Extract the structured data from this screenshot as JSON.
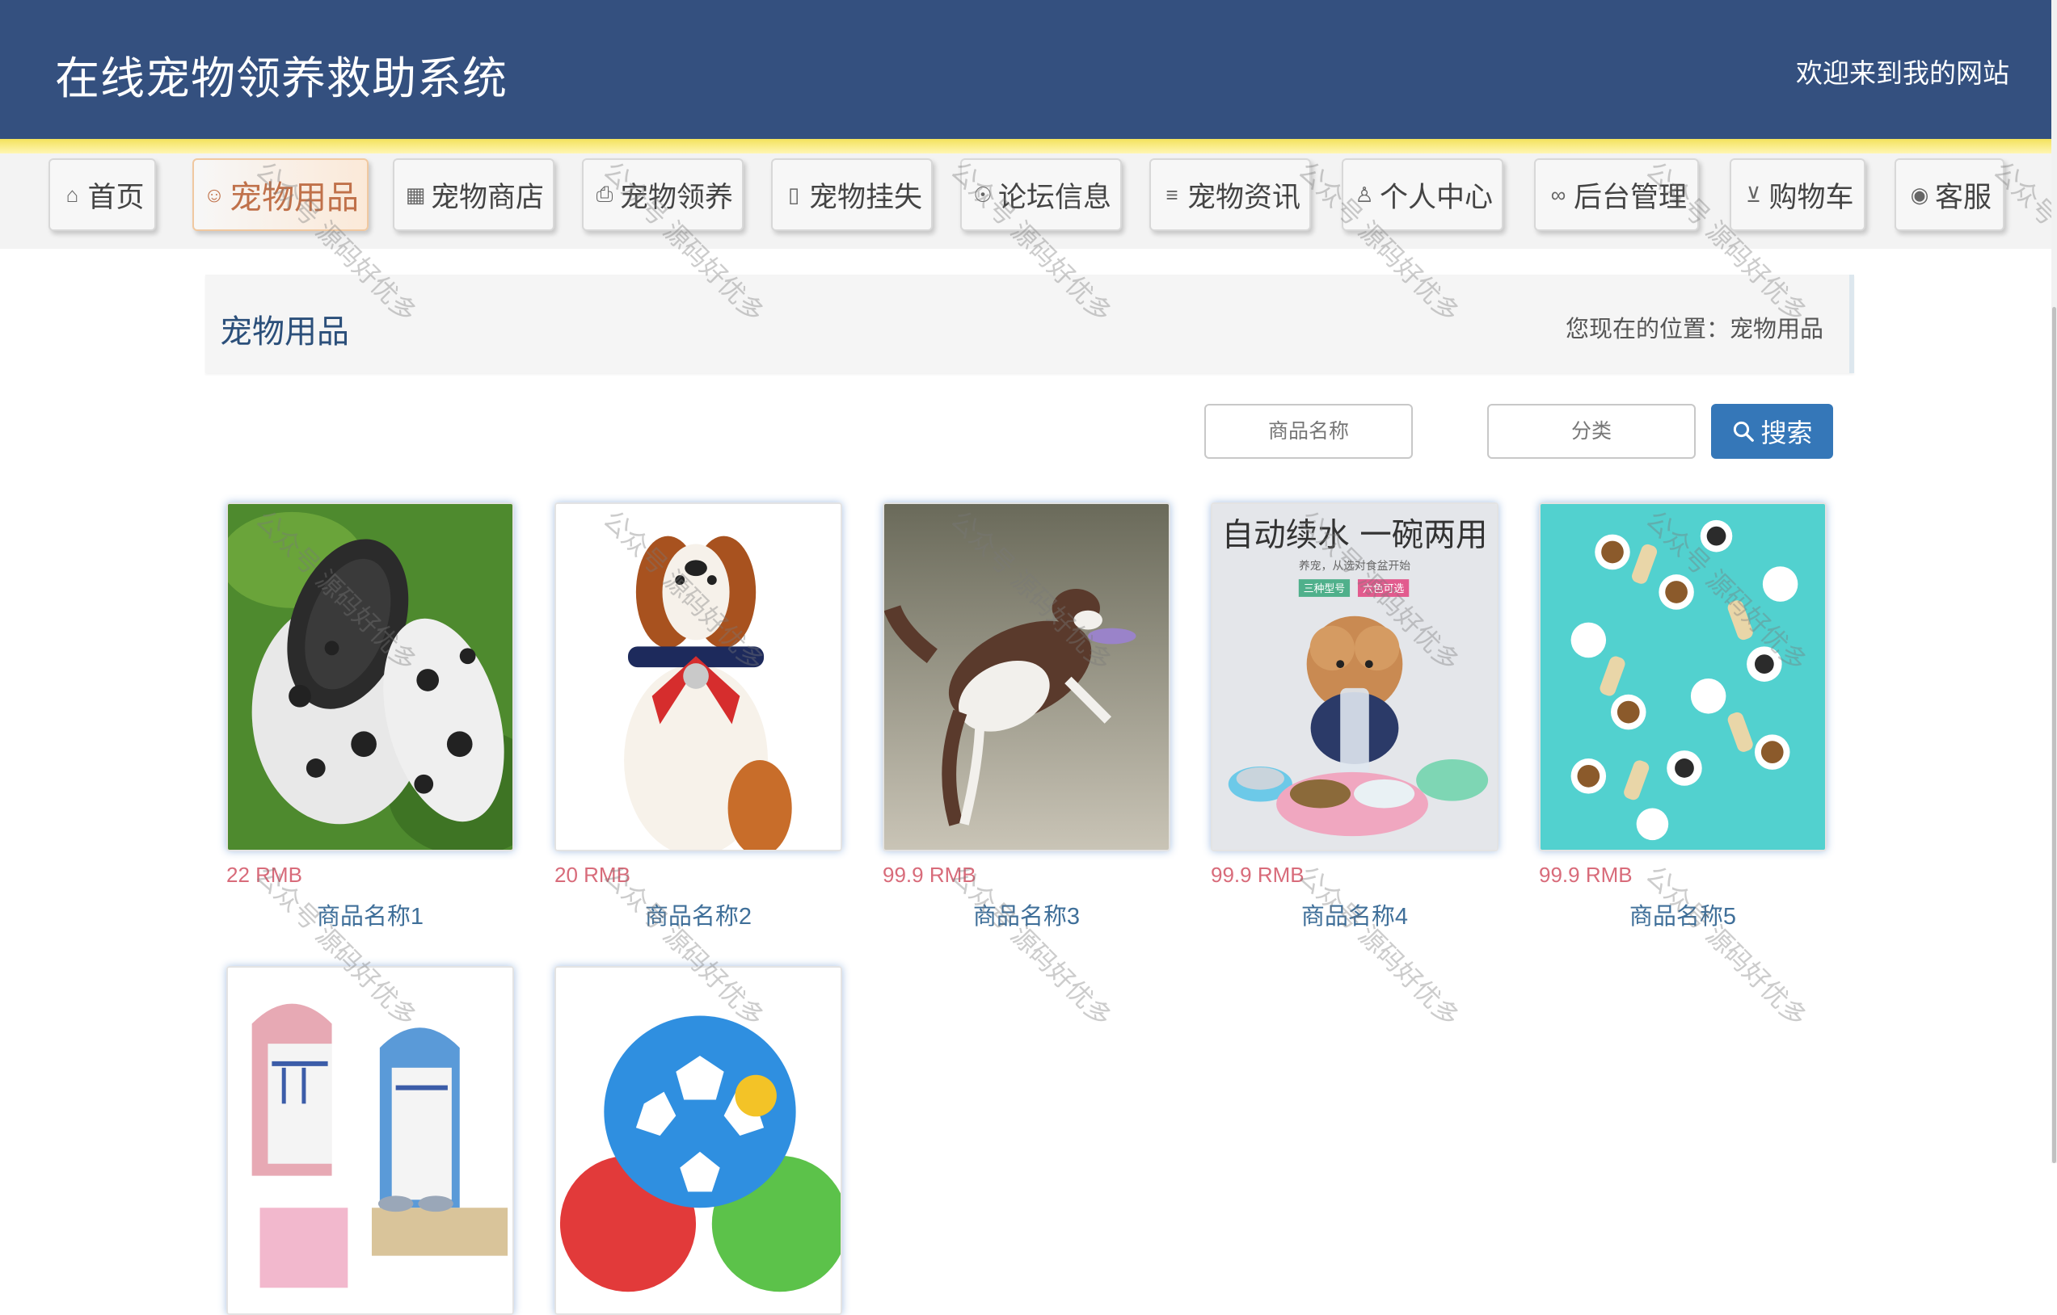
{
  "header": {
    "title": "在线宠物领养救助系统",
    "welcome": "欢迎来到我的网站"
  },
  "nav": {
    "items": [
      {
        "label": "首页",
        "icon": "home-icon",
        "glyph": "⌂"
      },
      {
        "label": "宠物用品",
        "icon": "smile-icon",
        "glyph": "☺",
        "active": true
      },
      {
        "label": "宠物商店",
        "icon": "grid-icon",
        "glyph": "▦"
      },
      {
        "label": "宠物领养",
        "icon": "printer-icon",
        "glyph": "⎙"
      },
      {
        "label": "宠物挂失",
        "icon": "columns-icon",
        "glyph": "▯"
      },
      {
        "label": "论坛信息",
        "icon": "gamepad-icon",
        "glyph": "☉"
      },
      {
        "label": "宠物资讯",
        "icon": "sliders-icon",
        "glyph": "≡"
      },
      {
        "label": "个人中心",
        "icon": "user-icon",
        "glyph": "♙"
      },
      {
        "label": "后台管理",
        "icon": "link-icon",
        "glyph": "∞"
      },
      {
        "label": "购物车",
        "icon": "cart-icon",
        "glyph": "⊻"
      },
      {
        "label": "客服",
        "icon": "chat-icon",
        "glyph": "◉"
      }
    ]
  },
  "breadcrumb": {
    "title": "宠物用品",
    "location": "您现在的位置：宠物用品"
  },
  "search": {
    "name_placeholder": "商品名称",
    "category_placeholder": "分类",
    "button_label": "搜索",
    "button_icon": "search-icon"
  },
  "products": [
    {
      "price": "22 RMB",
      "name": "商品名称1",
      "image": "pet-shoes-image"
    },
    {
      "price": "20 RMB",
      "name": "商品名称2",
      "image": "dog-bowtie-image"
    },
    {
      "price": "99.9 RMB",
      "name": "商品名称3",
      "image": "dog-frisbee-image"
    },
    {
      "price": "99.9 RMB",
      "name": "商品名称4",
      "image": "pet-bowl-image",
      "overlay_title": "自动续水 一碗两用",
      "overlay_sub": "养宠，从选对食盆开始",
      "overlay_tags": [
        "三种型号",
        "六色可选"
      ]
    },
    {
      "price": "99.9 RMB",
      "name": "商品名称5",
      "image": "dog-stickers-image"
    },
    {
      "price": "",
      "name": "",
      "image": "pet-furniture-image"
    },
    {
      "price": "",
      "name": "",
      "image": "dog-ball-image"
    }
  ],
  "watermark": "公众号 源码好优多",
  "colors": {
    "header_bg": "#34507f",
    "accent_yellow": "#f3e25c",
    "search_button": "#3577b8",
    "price": "#d86b7a",
    "product_name": "#3f6f99"
  }
}
